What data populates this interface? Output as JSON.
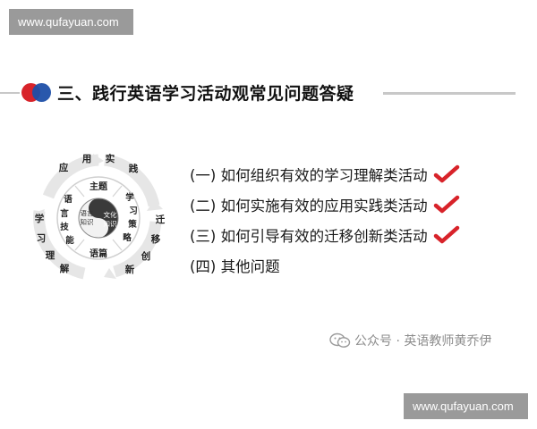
{
  "watermark": {
    "top": "www.qufayuan.com",
    "bottom": "www.qufayuan.com"
  },
  "header": {
    "title": "三、践行英语学习活动观常见问题答疑"
  },
  "diagram": {
    "outer_ring": [
      "应",
      "用",
      "实",
      "践",
      "迁",
      "移",
      "创",
      "新",
      "学",
      "习",
      "理",
      "解"
    ],
    "inner_ring": [
      "主题",
      "学",
      "习",
      "策",
      "略",
      "语篇",
      "能",
      "技",
      "言",
      "语"
    ],
    "center_left": [
      "语言",
      "知识"
    ],
    "center_right": [
      "文化",
      "知识"
    ]
  },
  "items": [
    {
      "label": "(一) 如何组织有效的学习理解类活动",
      "checked": true
    },
    {
      "label": "(二) 如何实施有效的应用实践类活动",
      "checked": true
    },
    {
      "label": "(三) 如何引导有效的迁移创新类活动",
      "checked": true
    },
    {
      "label": "(四) 其他问题",
      "checked": false
    }
  ],
  "colors": {
    "check": "#d8232a",
    "accent_red": "#d8232a",
    "accent_blue": "#1e4fa8"
  },
  "footer": {
    "source": "公众号 · 英语教师黄乔伊",
    "icon": "wechat-icon"
  }
}
